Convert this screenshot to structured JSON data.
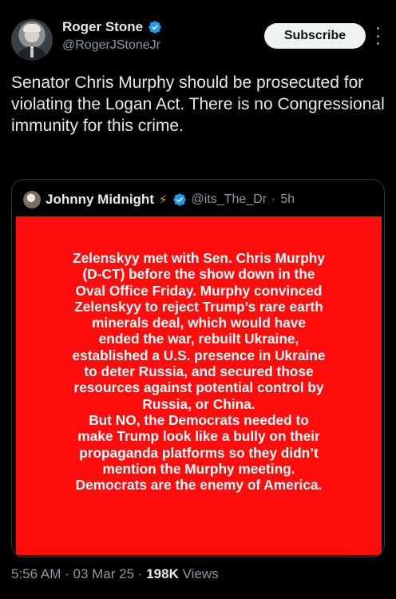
{
  "author": {
    "display_name": "Roger Stone",
    "handle": "@RogerJStoneJr",
    "verified_color": "#1d9bf0"
  },
  "actions": {
    "subscribe_label": "Subscribe",
    "more_icon": "more-vertical-icon"
  },
  "tweet": {
    "text": "Senator Chris Murphy should be prosecuted for violating the Logan Act. There is no Congressional immunity for this crime."
  },
  "quote": {
    "display_name": "Johnny Midnight",
    "emoji": "⚡",
    "handle": "@its_The_Dr",
    "separator": "·",
    "time": "5h",
    "image_background": "#ff0d0d",
    "image_text_lines": [
      "Zelenskyy met with Sen. Chris Murphy",
      "(D-CT) before the show down in the",
      "Oval Office Friday.  Murphy convinced",
      "Zelenskyy to reject Trump’s rare earth",
      "minerals deal, which would have",
      "ended the war, rebuilt Ukraine,",
      "established a U.S. presence in Ukraine",
      "to deter Russia, and secured those",
      "resources against potential control by",
      "Russia, or China.",
      "But NO, the Democrats needed to",
      "make Trump look like a bully on their",
      "propaganda platforms so they didn’t",
      "mention the Murphy meeting.",
      "Democrats are the enemy of America."
    ]
  },
  "meta": {
    "time": "5:56 AM",
    "date": "03 Mar 25",
    "separator": "·",
    "views_count": "198K",
    "views_label": "Views"
  }
}
